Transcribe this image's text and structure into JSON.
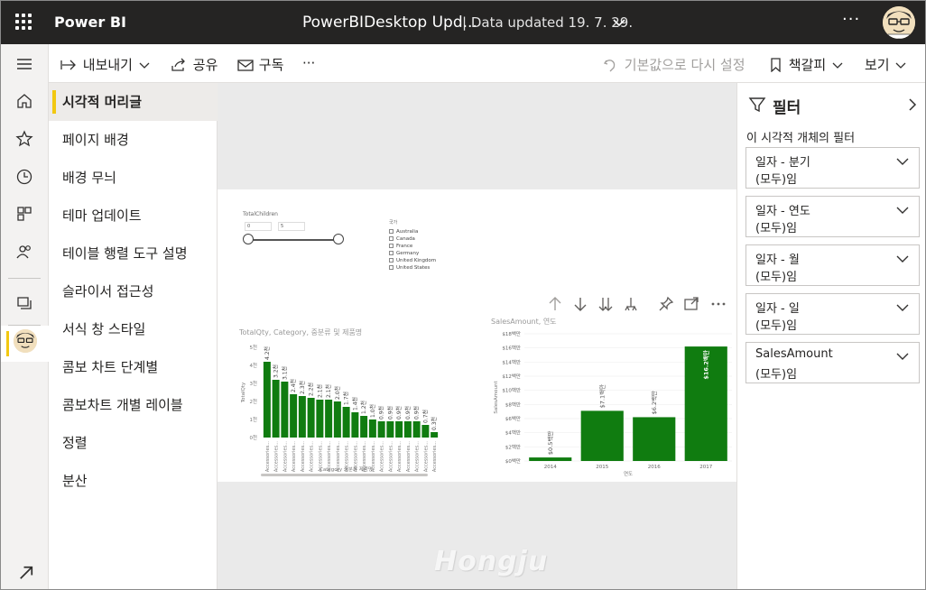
{
  "topbar": {
    "app_name": "Power BI",
    "doc_title": "PowerBIDesktop Upd...",
    "doc_updated": "| Data updated 19. 7. 29.",
    "more": "···"
  },
  "actions": {
    "export": "내보내기",
    "share": "공유",
    "subscribe": "구독",
    "more": "···",
    "reset": "기본값으로 다시 설정",
    "bookmarks": "책갈피",
    "view": "보기"
  },
  "format_items": [
    "시각적 머리글",
    "페이지 배경",
    "배경 무늬",
    "테마 업데이트",
    "테이블 행렬 도구 설명",
    "슬라이서 접근성",
    "서식 창 스타일",
    "콤보 차트 단계별",
    "콤보차트 개별 레이블",
    "정렬",
    "분산"
  ],
  "canvas": {
    "watermark": "Hongju",
    "slicer": {
      "title": "TotalChildren",
      "min": "0",
      "max": "5",
      "level_low": 0,
      "level_high": 1
    },
    "country_slicer": {
      "title": "국가",
      "items": [
        "Australia",
        "Canada",
        "France",
        "Germany",
        "United Kingdom",
        "United States"
      ]
    }
  },
  "filters": {
    "title": "필터",
    "subtitle": "이 시각적 개체의 필터",
    "cards": [
      {
        "name": "일자 - 분기",
        "value": "(모두)임"
      },
      {
        "name": "일자 - 연도",
        "value": "(모두)임"
      },
      {
        "name": "일자 - 월",
        "value": "(모두)임"
      },
      {
        "name": "일자 - 일",
        "value": "(모두)임"
      },
      {
        "name": "SalesAmount",
        "value": "(모두)임"
      }
    ]
  },
  "colors": {
    "bar": "#107c10",
    "accent": "#f2c811",
    "topbar": "#252423"
  },
  "chart_data": [
    {
      "type": "bar",
      "title": "TotalQty, Category, 중분류 및 제품명",
      "xlabel": "Category 중분류 제품명",
      "ylabel": "TotalQty",
      "ylim": [
        0,
        5
      ],
      "yticks": [
        "0천",
        "1천",
        "2천",
        "3천",
        "4천",
        "5천"
      ],
      "categories": [
        "Accessories...",
        "Accessories...",
        "Accessories...",
        "Accessories...",
        "Accessories...",
        "Accessories...",
        "Accessories...",
        "Accessories...",
        "Accessories...",
        "Accessories...",
        "Accessories...",
        "Accessories...",
        "Accessories...",
        "Accessories...",
        "Accessories...",
        "Accessories...",
        "Accessories...",
        "Accessories...",
        "Accessories...",
        "Accessories..."
      ],
      "values": [
        4.2,
        3.2,
        3.1,
        2.4,
        2.3,
        2.2,
        2.1,
        2.1,
        2.0,
        1.7,
        1.4,
        1.2,
        1.0,
        0.9,
        0.9,
        0.9,
        0.9,
        0.9,
        0.7,
        0.3
      ],
      "labels": [
        "4.2천",
        "3.2천",
        "3.1천",
        "2.4천",
        "2.3천",
        "2.2천",
        "2.1천",
        "2.1천",
        "2.0천",
        "1.7천",
        "1.4천",
        "1.2천",
        "1.0천",
        "0.9천",
        "0.9천",
        "0.9천",
        "0.9천",
        "0.9천",
        "0.7천",
        "0.3천"
      ],
      "grid": false
    },
    {
      "type": "bar",
      "title": "SalesAmount, 연도",
      "xlabel": "연도",
      "ylabel": "SalesAmount",
      "ylim": [
        0,
        18
      ],
      "yticks": [
        "$0백만",
        "$2백만",
        "$4백만",
        "$6백만",
        "$8백만",
        "$10백만",
        "$12백만",
        "$14백만",
        "$16백만",
        "$18백만"
      ],
      "categories": [
        "2014",
        "2015",
        "2016",
        "2017"
      ],
      "values": [
        0.5,
        7.1,
        6.2,
        16.2
      ],
      "labels": [
        "$0.5백만",
        "$7.1백만",
        "$6.2백만",
        "$16.2백만"
      ],
      "grid": true
    }
  ]
}
